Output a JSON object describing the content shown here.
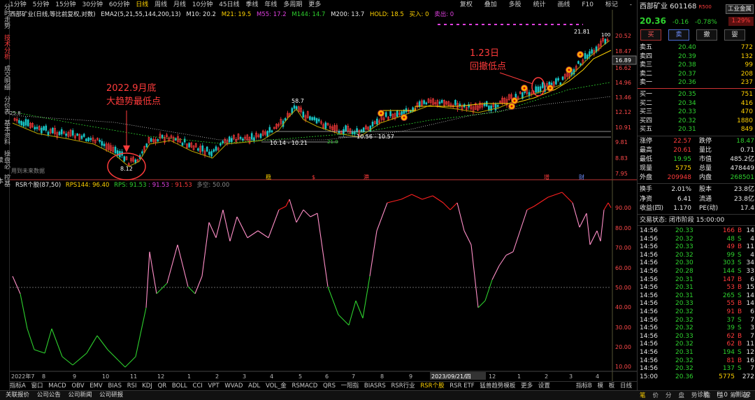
{
  "left_tabs": [
    "分时走势",
    "技术分析",
    "成交明细",
    "分价表",
    "基本资料",
    "操盘必读",
    "控基本"
  ],
  "toolbar": {
    "periods": [
      "1分钟",
      "5分钟",
      "15分钟",
      "30分钟",
      "60分钟",
      "日线",
      "周线",
      "月线",
      "10分钟",
      "45日线",
      "季线",
      "年线",
      "多周期",
      "更多"
    ],
    "active_period": "日线",
    "right_tools": [
      "复权",
      "叠加",
      "多股",
      "统计",
      "画线",
      "F10",
      "标记",
      "-"
    ]
  },
  "indicator_header": {
    "name": "西部矿业(日线,等比前复权,对数)",
    "ema": "EMA2(5,21,55,144,200,13)",
    "m10": "M10: 20.2",
    "m21": "M21: 19.5",
    "m55": "M55: 17.2",
    "m144": "M144: 14.7",
    "m200": "M200: 13.7",
    "hold": "HOLD: 18.5",
    "buy": "买入: 0",
    "sell": "卖出: 0"
  },
  "price_axis": [
    "20.52",
    "18.47",
    "16.62",
    "14.96",
    "13.46",
    "12.12",
    "10.91",
    "9.81",
    "8.83",
    "7.95"
  ],
  "current_price_tag": "16.89",
  "annotations": {
    "low_label_line1": "2022.9月底",
    "low_label_line2": "大趋势最低点",
    "jan_label_line1": "1.23日",
    "jan_label_line2": "回撤低点",
    "high_mark": "21.81",
    "high_mark2": "100",
    "p587": "58.7",
    "p812": "8.12",
    "range1": "10.14 - 10.21",
    "range2": "10.56 - 10.57",
    "p21": "21.0",
    "p258": "25.8",
    "future_data": "用到未来数据",
    "event_marks": [
      "稳",
      "$",
      "港",
      "增",
      "财"
    ]
  },
  "rsr_header": {
    "name": "RSR个股(87,50)",
    "rps144": "RPS144: 96.40",
    "rps": "RPS: 91.53",
    "rps_b": ": 91.53",
    "rps_c": ": 91.53",
    "duokong": "多空: 50.00"
  },
  "rsr_axis": [
    "90.00",
    "80.00",
    "70.00",
    "60.00",
    "50.00",
    "40.00",
    "30.00",
    "20.00",
    "10.00"
  ],
  "x_axis": [
    "2022年7",
    "8",
    "9",
    "10",
    "11",
    "12",
    "1",
    "2",
    "3",
    "4",
    "5",
    "6",
    "7",
    "8",
    "9",
    "2023/09/21/四",
    "12",
    "1",
    "2",
    "3",
    "4"
  ],
  "bottom_tabs": [
    "指标A",
    "窗口",
    "MACD",
    "OBV",
    "EMV",
    "BIAS",
    "RSI",
    "KDJ",
    "QR",
    "BOLL",
    "CCI",
    "VPT",
    "WVAD",
    "ADL",
    "VOL_金",
    "RSMACD",
    "QRS",
    "一阳指",
    "BIASRS",
    "RSR行业",
    "RSR个股",
    "RSR ETF",
    "猛兽趋势模板",
    "更多",
    "设置"
  ],
  "bottom_tabs_active": "RSR个股",
  "bottom_right": [
    "指标B",
    "模",
    "板",
    "日线"
  ],
  "status_bar": [
    "关联报价",
    "公司公告",
    "公司新闻",
    "公司研报"
  ],
  "status_right": [
    "诊股",
    "F10",
    "侧边2"
  ],
  "quote": {
    "name": "西部矿业 601168",
    "tag_r": "R",
    "tag_500": "500",
    "sector": "工业金属",
    "sector_pct": "1.29%",
    "price": "20.36",
    "change": "-0.16",
    "change_pct": "-0.78%",
    "buttons": [
      "买",
      "卖",
      "撤",
      "婴"
    ],
    "asks": [
      {
        "label": "卖五",
        "price": "20.40",
        "vol": "772"
      },
      {
        "label": "卖四",
        "price": "20.39",
        "vol": "132"
      },
      {
        "label": "卖三",
        "price": "20.38",
        "vol": "99"
      },
      {
        "label": "卖二",
        "price": "20.37",
        "vol": "208"
      },
      {
        "label": "卖一",
        "price": "20.36",
        "vol": "237"
      }
    ],
    "bids": [
      {
        "label": "买一",
        "price": "20.35",
        "vol": "751"
      },
      {
        "label": "买二",
        "price": "20.34",
        "vol": "416"
      },
      {
        "label": "买三",
        "price": "20.33",
        "vol": "470"
      },
      {
        "label": "买四",
        "price": "20.32",
        "vol": "1880"
      },
      {
        "label": "买五",
        "price": "20.31",
        "vol": "849"
      }
    ],
    "stats": [
      {
        "l1": "涨停",
        "v1": "22.57",
        "l2": "跌停",
        "v2": "18.47"
      },
      {
        "l1": "最高",
        "v1": "20.61",
        "l2": "量比",
        "v2": "0.71"
      },
      {
        "l1": "最低",
        "v1": "19.95",
        "l2": "市值",
        "v2": "485.2亿"
      },
      {
        "l1": "现量",
        "v1": "5775",
        "l2": "总量",
        "v2": "478449"
      },
      {
        "l1": "外盘",
        "v1": "209948",
        "l2": "内盘",
        "v2": "268501"
      }
    ],
    "stats2": [
      {
        "l1": "换手",
        "v1": "2.01%",
        "l2": "股本",
        "v2": "23.8亿"
      },
      {
        "l1": "净资",
        "v1": "6.41",
        "l2": "流通",
        "v2": "23.8亿"
      },
      {
        "l1": "收益(四)",
        "v1": "1.170",
        "l2": "PE(动)",
        "v2": "17.4"
      }
    ],
    "trade_status": "交易状态: 闭市阶段 15:00:00",
    "ticks": [
      {
        "t": "14:56",
        "p": "20.33",
        "v": "166",
        "s": "B",
        "n": "14"
      },
      {
        "t": "14:56",
        "p": "20.32",
        "v": "48",
        "s": "S",
        "n": "4"
      },
      {
        "t": "14:56",
        "p": "20.33",
        "v": "49",
        "s": "B",
        "n": "11"
      },
      {
        "t": "14:56",
        "p": "20.32",
        "v": "99",
        "s": "S",
        "n": "4"
      },
      {
        "t": "14:56",
        "p": "20.30",
        "v": "303",
        "s": "S",
        "n": "34"
      },
      {
        "t": "14:56",
        "p": "20.28",
        "v": "144",
        "s": "S",
        "n": "33"
      },
      {
        "t": "14:56",
        "p": "20.31",
        "v": "147",
        "s": "B",
        "n": "6"
      },
      {
        "t": "14:56",
        "p": "20.31",
        "v": "53",
        "s": "B",
        "n": "15"
      },
      {
        "t": "14:56",
        "p": "20.31",
        "v": "265",
        "s": "S",
        "n": "14"
      },
      {
        "t": "14:56",
        "p": "20.33",
        "v": "55",
        "s": "B",
        "n": "14"
      },
      {
        "t": "14:56",
        "p": "20.32",
        "v": "91",
        "s": "B",
        "n": "6"
      },
      {
        "t": "14:56",
        "p": "20.32",
        "v": "37",
        "s": "S",
        "n": "7"
      },
      {
        "t": "14:56",
        "p": "20.32",
        "v": "39",
        "s": "S",
        "n": "3"
      },
      {
        "t": "14:56",
        "p": "20.33",
        "v": "62",
        "s": "B",
        "n": "7"
      },
      {
        "t": "14:56",
        "p": "20.32",
        "v": "62",
        "s": "B",
        "n": "11"
      },
      {
        "t": "14:56",
        "p": "20.31",
        "v": "194",
        "s": "S",
        "n": "12"
      },
      {
        "t": "14:56",
        "p": "20.32",
        "v": "81",
        "s": "B",
        "n": "16"
      },
      {
        "t": "14:56",
        "p": "20.32",
        "v": "137",
        "s": "S",
        "n": "7"
      },
      {
        "t": "15:00",
        "p": "20.36",
        "v": "5775",
        "s": "",
        "n": "272"
      }
    ],
    "tick_footer": [
      "笔",
      "价",
      "分",
      "盘",
      "势",
      "指",
      "主",
      "筹",
      "值"
    ]
  },
  "colors": {
    "up": "#ff3b3b",
    "down": "#2ed12e",
    "accent": "#ffd200",
    "ema144": "#b8a200"
  }
}
